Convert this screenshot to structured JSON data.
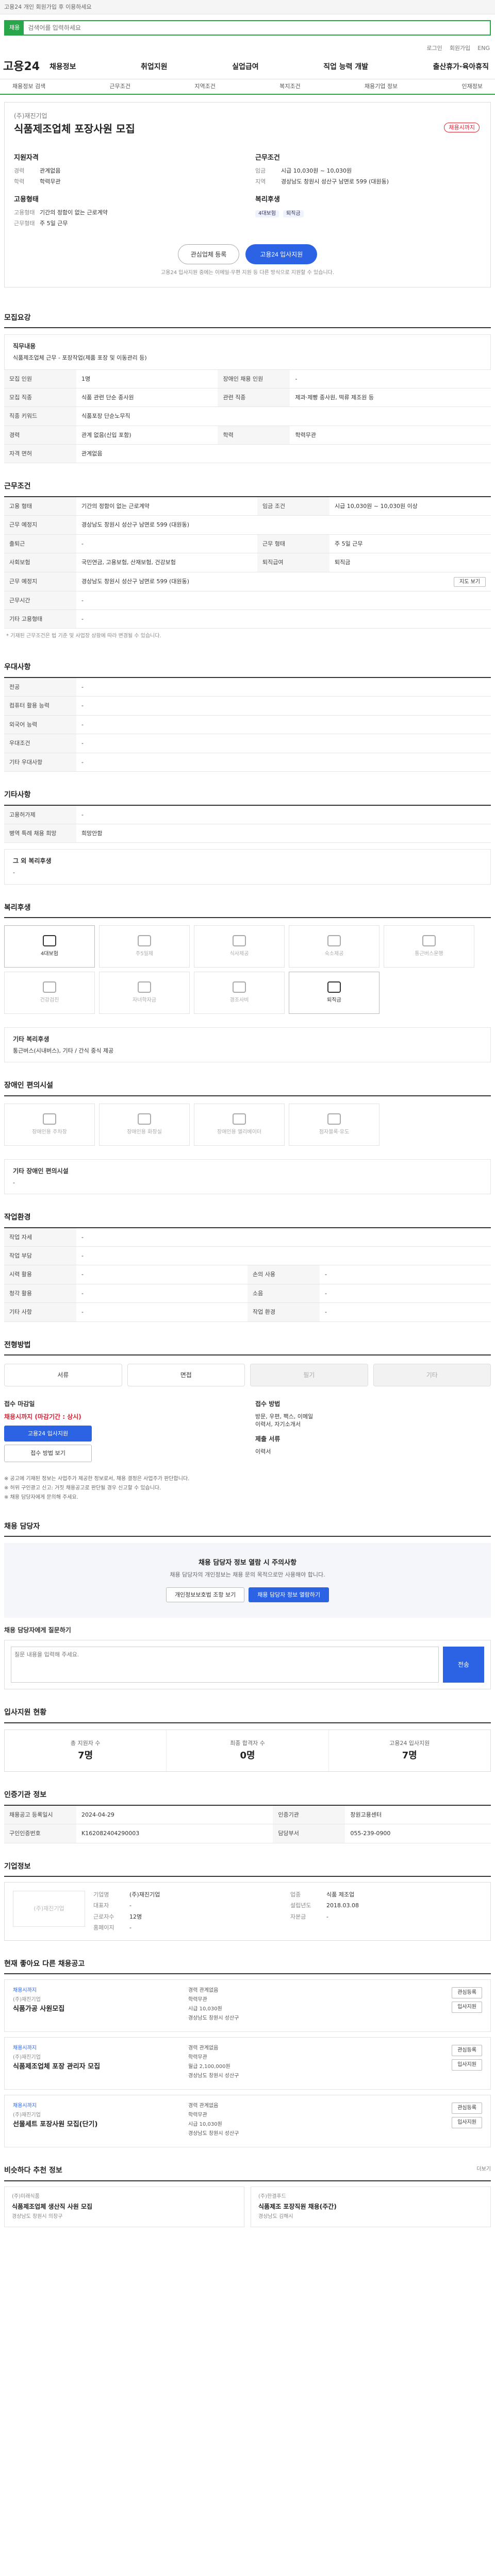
{
  "topbar": {
    "notice": "고용24 개인 회원가입 후 이용하세요",
    "search_tag": "채용",
    "search_placeholder": "검색어를 입력하세요",
    "links": [
      "로그인",
      "회원가입",
      "ENG"
    ]
  },
  "gnb": {
    "logo": "고용24",
    "menu": [
      "채용정보",
      "취업지원",
      "실업급여",
      "직업 능력 개발",
      "출산휴가·육아휴직"
    ],
    "sub": [
      "채용정보 검색",
      "근무조건",
      "지역조건",
      "복지조건",
      "채용기업 정보",
      "인재정보"
    ]
  },
  "job": {
    "company": "(주)재진기업",
    "title": "식품제조업체 포장사원 모집",
    "dday": "채용시까지",
    "summary_left_h": "지원자격",
    "exp_k": "경력",
    "exp_v": "관계없음",
    "edu_k": "학력",
    "edu_v": "학력무관",
    "summary_right_h": "근무조건",
    "pay_k": "임금",
    "pay_v": "시급 10,030원 ~ 10,030원",
    "loc_k": "지역",
    "loc_v": "경상남도 창원시 성산구 남면로 599 (대원동)",
    "type_h": "고용형태",
    "type_k": "고용형태",
    "type_v": "기간의 정함이 없는 근로계약",
    "time_k": "근무형태",
    "time_v": "주 5일 근무",
    "welfare_h": "복리후생",
    "welfare_chips": [
      "4대보험",
      "퇴직금"
    ],
    "btn_interest": "관심업체 등록",
    "btn_apply": "고용24 입사지원",
    "cta_note": "고용24 입사지원 중에는 이메일·우편 지원 등 다른 방식으로 지원할 수 있습니다."
  },
  "sections": {
    "recruit": {
      "title": "모집요강",
      "job_k": "직무내용",
      "job_v": "식품제조업체 근무 - 포장작업(제품 포장 및 이동관리 등)",
      "rows": [
        [
          "모집 인원",
          "1명",
          "장애인 채용 인원",
          "-"
        ],
        [
          "모집 직종",
          "식품 관련 단순 종사원",
          "관련 직종",
          "제과·제빵 종사원, 떡류 제조원 등"
        ],
        [
          "직종 키워드",
          "식품포장 단순노무직",
          "",
          ""
        ],
        [
          "경력",
          "관계 없음(신입 포함)",
          "학력",
          "학력무관"
        ],
        [
          "자격 면허",
          "관계없음",
          "",
          ""
        ]
      ]
    },
    "work": {
      "title": "근무조건",
      "rows": [
        [
          "고용 형태",
          "기간의 정함이 없는 근로계약",
          "임금 조건",
          "시급 10,030원 ~ 10,030원 이상"
        ],
        [
          "근무 예정지",
          "경상남도 창원시 성산구 남면로 599 (대원동)",
          "",
          ""
        ],
        [
          "출퇴근",
          "-",
          "근무 형태",
          "주 5일 근무"
        ],
        [
          "사회보험",
          "국민연금, 고용보험, 산재보험, 건강보험",
          "퇴직급여",
          "퇴직금"
        ],
        [
          "근무 예정지",
          "경상남도 창원시 성산구 남면로 599 (대원동)",
          "",
          ""
        ],
        [
          "근무시간",
          "-",
          "",
          ""
        ],
        [
          "기타 고용형태",
          "-",
          "",
          ""
        ]
      ],
      "map_btn": "지도 보기",
      "note": "* 기재된 근무조건은 법 기준 및 사업장 상황에 따라 변경될 수 있습니다."
    },
    "prefer": {
      "title": "우대사항",
      "rows": [
        [
          "전공",
          "-"
        ],
        [
          "컴퓨터 활용 능력",
          "-"
        ],
        [
          "외국어 능력",
          "-"
        ],
        [
          "우대조건",
          "-"
        ],
        [
          "기타 우대사항",
          "-"
        ]
      ]
    },
    "etc": {
      "title": "기타사항",
      "rows": [
        [
          "고용허가제",
          "-"
        ],
        [
          "병역 특례 채용 희망",
          "희망안함"
        ]
      ],
      "box_title": "그 외 복리후생",
      "box_text": "-"
    },
    "welfare": {
      "title": "복리후생",
      "items": [
        {
          "label": "4대보험",
          "on": true
        },
        {
          "label": "주5일제",
          "on": false
        },
        {
          "label": "식사제공",
          "on": false
        },
        {
          "label": "숙소제공",
          "on": false
        },
        {
          "label": "통근버스운행",
          "on": false
        },
        {
          "label": "건강검진",
          "on": false
        },
        {
          "label": "자녀학자금",
          "on": false
        },
        {
          "label": "경조사비",
          "on": false
        },
        {
          "label": "퇴직금",
          "on": true
        }
      ],
      "box_title": "기타 복리후생",
      "box_text": "통근버스(시내버스), 기타 / 간식 중식 제공"
    },
    "disabled": {
      "title": "장애인 편의시설",
      "items": [
        "장애인용 주차장",
        "장애인용 화장실",
        "장애인용 엘리베이터",
        "점자블록·유도"
      ],
      "box_title": "기타 장애인 편의시설",
      "box_text": "-"
    },
    "workenv": {
      "title": "작업환경",
      "rows": [
        [
          "작업 자세",
          "-",
          "",
          ""
        ],
        [
          "작업 부담",
          "-",
          "",
          ""
        ],
        [
          "시력 활용",
          "-",
          "손의 사용",
          "-"
        ],
        [
          "청각 활용",
          "-",
          "소음",
          "-"
        ],
        [
          "기타 사항",
          "-",
          "작업 환경",
          "-"
        ]
      ]
    },
    "apply": {
      "title": "전형방법",
      "steps": [
        {
          "label": "서류",
          "on": true
        },
        {
          "label": "면접",
          "on": true
        },
        {
          "label": "필기",
          "on": false
        },
        {
          "label": "기타",
          "on": false
        }
      ],
      "period_h": "접수 마감일",
      "period_v": "채용시까지 (마감기간 : 상시)",
      "btn_apply": "고용24 입사지원",
      "btn_doc": "접수 방법 보기",
      "method_h": "접수 방법",
      "method_v": "방문, 우편, 팩스, 이메일",
      "method_extra": "이력서, 자기소개서",
      "doc_h": "제출 서류",
      "doc_v": "이력서",
      "notes": [
        "※ 공고에 기재된 정보는 사업주가 제공한 정보로서, 채용 결정은 사업주가 판단합니다.",
        "※ 허위 구인광고 신고: 거짓 채용공고로 판단될 경우 신고할 수 있습니다.",
        "※ 채용 담당자에게 문의해 주세요."
      ]
    },
    "manager": {
      "title": "채용 담당자",
      "warn": "채용 담당자 정보 열람 시 주의사항",
      "text": "채용 담당자의 개인정보는 채용 문의 목적으로만 사용해야 합니다.",
      "btn1": "개인정보보호법 조항 보기",
      "btn2": "채용 담당자 정보 열람하기",
      "qa_title": "채용 담당자에게 질문하기",
      "qa_placeholder": "질문 내용을 입력해 주세요.",
      "qa_btn": "전송"
    },
    "stats": {
      "title": "입사지원 현황",
      "items": [
        {
          "label": "총 지원자 수",
          "value": "7명"
        },
        {
          "label": "최종 합격자 수",
          "value": "0명"
        },
        {
          "label": "고용24 입사지원",
          "value": "7명"
        }
      ]
    },
    "regist": {
      "title": "인증기관 정보",
      "rows": [
        [
          "채용공고 등록일시",
          "2024-04-29",
          "인증기관",
          "창원고용센터"
        ],
        [
          "구인인증번호",
          "K162082404290003",
          "담당부서",
          "055-239-0900"
        ]
      ]
    },
    "company": {
      "title": "기업정보",
      "logo": "(주)재진기업",
      "fields": [
        [
          "기업명",
          "(주)재진기업",
          "업종",
          "식품 제조업"
        ],
        [
          "대표자",
          "-",
          "설립년도",
          "2018.03.08"
        ],
        [
          "근로자수",
          "12명",
          "자본금",
          "-"
        ],
        [
          "홈페이지",
          "-",
          "",
          ""
        ]
      ]
    },
    "related": {
      "title": "현재 좋아요 다른 채용공고",
      "cards": [
        {
          "tag": "채용시까지",
          "company": "(주)재진기업",
          "title": "식품가공 사원모집",
          "meta": [
            "경력 관계없음",
            "학력무관",
            "시급 10,030원",
            "경상남도 창원시 성산구"
          ]
        },
        {
          "tag": "채용시까지",
          "company": "(주)재진기업",
          "title": "식품제조업체 포장 관리자 모집",
          "meta": [
            "경력 관계없음",
            "학력무관",
            "월급 2,100,000원",
            "경상남도 창원시 성산구"
          ]
        },
        {
          "tag": "채용시까지",
          "company": "(주)재진기업",
          "title": "선물세트 포장사원 모집(단기)",
          "meta": [
            "경력 관계없음",
            "학력무관",
            "시급 10,030원",
            "경상남도 창원시 성산구"
          ]
        }
      ],
      "btn_interest": "관심등록",
      "btn_apply": "입사지원"
    },
    "news": {
      "title": "비슷하다 추천 정보",
      "more": "더보기",
      "cards": [
        {
          "company": "(주)미래식품",
          "title": "식품제조업체 생산직 사원 모집",
          "meta": "경상남도 창원시 의창구"
        },
        {
          "company": "(주)한결푸드",
          "title": "식품제조 포장직원 채용(주간)",
          "meta": "경상남도 김해시"
        }
      ]
    }
  }
}
